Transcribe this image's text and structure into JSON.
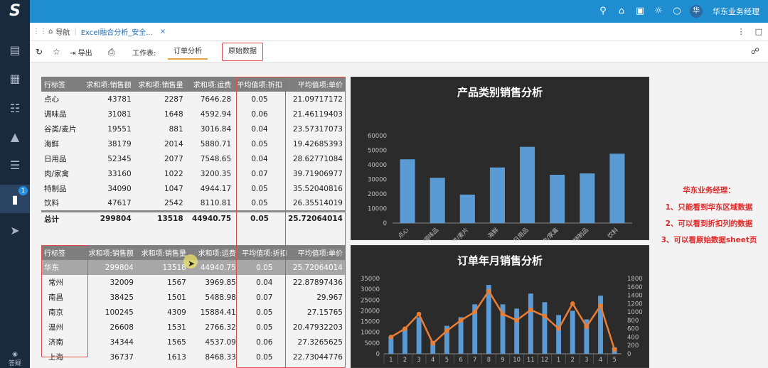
{
  "app": {
    "logo": "S",
    "user": {
      "avatar": "华",
      "name": "华东业务经理"
    }
  },
  "icons": [
    "search-icon",
    "home-icon",
    "bag-icon",
    "gauge-icon",
    "chat-icon",
    "vertical-more-icon",
    "share-icon",
    "grip-icon"
  ],
  "sidebar": {
    "badge": "1",
    "bottom_label": "答疑"
  },
  "tabs": {
    "nav_label": "导航",
    "doc_label": "Excel融合分析_安全..."
  },
  "toolbar": {
    "export_label": "导出",
    "worksheet_label": "工作表:",
    "sheet_tabs": [
      "订单分析",
      "原始数据"
    ]
  },
  "table1": {
    "headers": [
      "行标签",
      "求和项:销售额",
      "求和项:销售量",
      "求和项:运费",
      "平均值项:折扣",
      "平均值项:单价"
    ],
    "rows": [
      [
        "点心",
        "43781",
        "2287",
        "7646.28",
        "0.05",
        "21.09717172"
      ],
      [
        "调味品",
        "31081",
        "1648",
        "4592.94",
        "0.06",
        "21.46119403"
      ],
      [
        "谷类/麦片",
        "19551",
        "881",
        "3016.84",
        "0.04",
        "23.57317073"
      ],
      [
        "海鲜",
        "38179",
        "2014",
        "5880.71",
        "0.05",
        "19.42685393"
      ],
      [
        "日用品",
        "52345",
        "2077",
        "7548.65",
        "0.04",
        "28.62771084"
      ],
      [
        "肉/家禽",
        "33160",
        "1022",
        "3200.35",
        "0.07",
        "39.71906977"
      ],
      [
        "特制品",
        "34090",
        "1047",
        "4944.17",
        "0.05",
        "35.52040816"
      ],
      [
        "饮料",
        "47617",
        "2542",
        "8110.81",
        "0.05",
        "26.35514019"
      ]
    ],
    "total": [
      "总计",
      "299804",
      "13518",
      "44940.75",
      "0.05",
      "25.72064014"
    ]
  },
  "table2": {
    "headers": [
      "行标签",
      "求和项:销售额",
      "求和项:销售量",
      "求和项:运费",
      "平均值项:折扣",
      "平均值项:单价"
    ],
    "region": [
      "华东",
      "299804",
      "13518",
      "44940.75",
      "0.05",
      "25.72064014"
    ],
    "rows": [
      [
        "常州",
        "32009",
        "1567",
        "3969.85",
        "0.04",
        "22.87897436"
      ],
      [
        "南昌",
        "38425",
        "1501",
        "5488.98",
        "0.07",
        "29.967"
      ],
      [
        "南京",
        "100245",
        "4309",
        "15884.41",
        "0.05",
        "27.15765"
      ],
      [
        "温州",
        "26608",
        "1531",
        "2766.32",
        "0.05",
        "20.47932203"
      ],
      [
        "济南",
        "34344",
        "1565",
        "4537.09",
        "0.06",
        "27.3265625"
      ],
      [
        "上海",
        "36737",
        "1613",
        "8468.33",
        "0.05",
        "22.73044776"
      ]
    ]
  },
  "notes": {
    "title": "华东业务经理：",
    "lines": [
      "1、只能看到华东区域数据",
      "2、可以看到折扣列的数据",
      "3、可以看原始数据sheet页"
    ]
  },
  "chart_data": [
    {
      "type": "bar",
      "title": "产品类别销售分析",
      "categories": [
        "点心",
        "调味品",
        "谷类/麦片",
        "海鲜",
        "日用品",
        "肉/家禽",
        "特制品",
        "饮料"
      ],
      "values": [
        43781,
        31081,
        19551,
        38179,
        52345,
        33160,
        34090,
        47617
      ],
      "ylim": [
        0,
        60000
      ],
      "yticks": [
        "0",
        "10000",
        "20000",
        "30000",
        "40000",
        "50000",
        "60000"
      ],
      "grid": false,
      "colors": {
        "bar": "#5b9bd5",
        "background": "#2b2b2b",
        "text": "#bfbfbf"
      }
    },
    {
      "type": "bar",
      "title": "订单年月销售分析",
      "categories": [
        "1",
        "2",
        "3",
        "4",
        "5",
        "6",
        "7",
        "8",
        "9",
        "10",
        "11",
        "12",
        "1",
        "2",
        "3",
        "4",
        "5"
      ],
      "series": [
        {
          "type": "bar",
          "values": [
            8000,
            12000,
            17000,
            6000,
            13000,
            17000,
            23000,
            32000,
            23000,
            21000,
            28000,
            24000,
            18000,
            20000,
            16000,
            27000,
            3000
          ]
        },
        {
          "type": "line",
          "axis": "right",
          "values": [
            400,
            600,
            950,
            250,
            550,
            800,
            1000,
            1500,
            950,
            800,
            1050,
            900,
            600,
            1200,
            650,
            1150,
            100
          ]
        }
      ],
      "ylim": [
        0,
        35000
      ],
      "yticks": [
        "0",
        "5000",
        "10000",
        "15000",
        "20000",
        "25000",
        "30000",
        "35000"
      ],
      "y2lim": [
        0,
        1800
      ],
      "y2ticks": [
        "0",
        "200",
        "400",
        "600",
        "800",
        "1000",
        "1200",
        "1400",
        "1600",
        "1800"
      ],
      "colors": {
        "bar": "#5b9bd5",
        "line": "#ed7d31",
        "background": "#2b2b2b",
        "text": "#bfbfbf"
      }
    }
  ]
}
